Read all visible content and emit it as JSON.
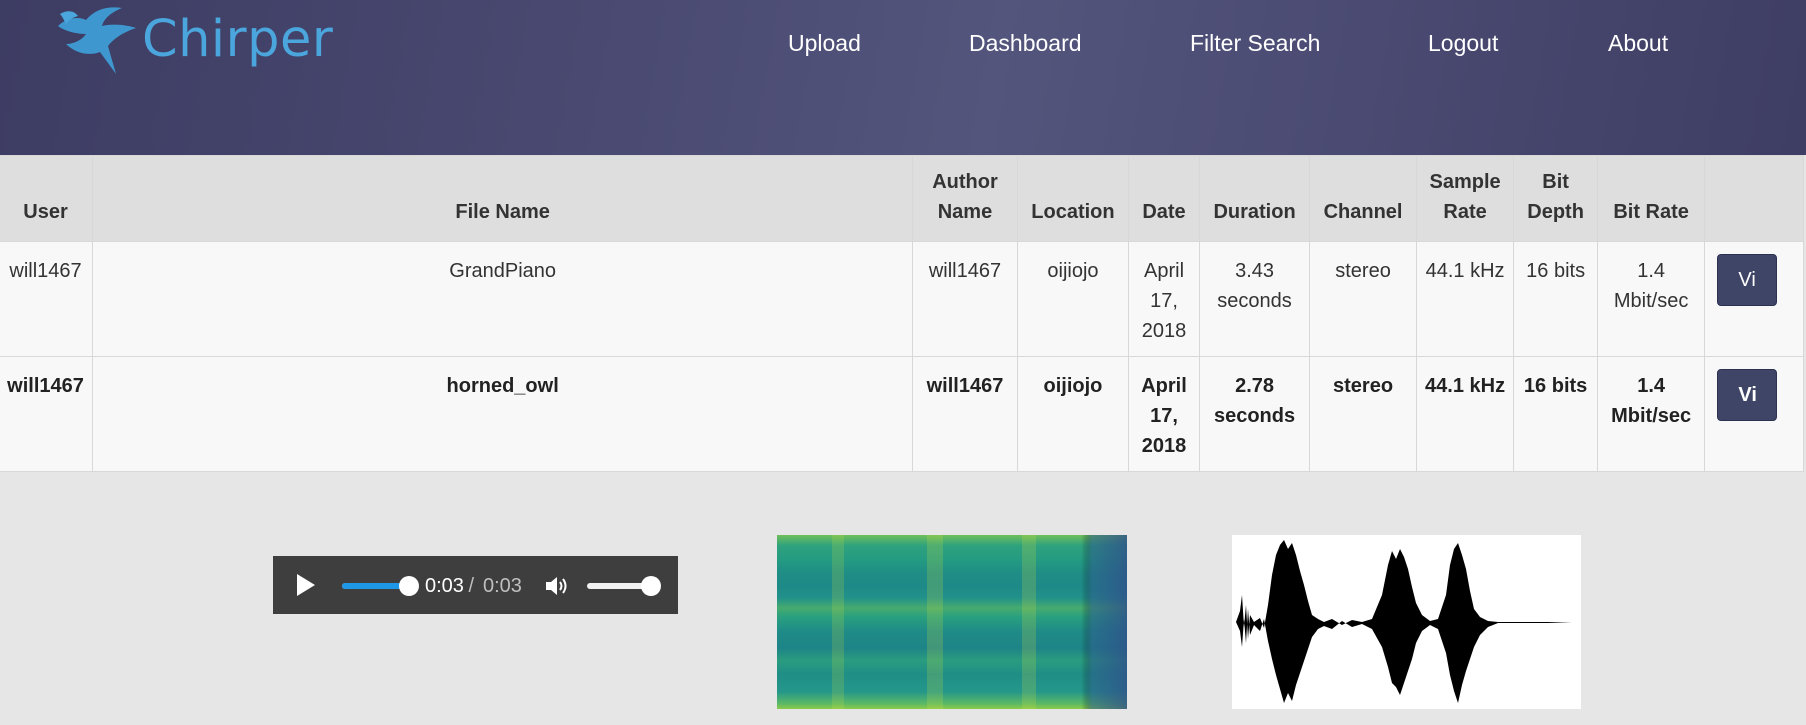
{
  "brand": {
    "name": "Chirper",
    "logo_color": "#4aa6dc"
  },
  "nav": {
    "items": [
      "Upload",
      "Dashboard",
      "Filter Search",
      "Logout",
      "About"
    ]
  },
  "table": {
    "headers": [
      "User",
      "File Name",
      "Author Name",
      "Location",
      "Date",
      "Duration",
      "Channel",
      "Sample Rate",
      "Bit Depth",
      "Bit Rate",
      ""
    ],
    "rows": [
      {
        "user": "will1467",
        "file_name": "GrandPiano",
        "author": "will1467",
        "location": "oijiojo",
        "date": "April 17, 2018",
        "duration": "3.43 seconds",
        "channel": "stereo",
        "sample_rate": "44.1 kHz",
        "bit_depth": "16 bits",
        "bit_rate": "1.4 Mbit/sec",
        "action": "Vi",
        "selected": false
      },
      {
        "user": "will1467",
        "file_name": "horned_owl",
        "author": "will1467",
        "location": "oijiojo",
        "date": "April 17, 2018",
        "duration": "2.78 seconds",
        "channel": "stereo",
        "sample_rate": "44.1 kHz",
        "bit_depth": "16 bits",
        "bit_rate": "1.4 Mbit/sec",
        "action": "Vi",
        "selected": true
      }
    ]
  },
  "player": {
    "current_time": "0:03",
    "separator": " / ",
    "duration": "0:03",
    "progress": 1.0,
    "volume": 1.0,
    "play_icon": "play-icon",
    "volume_icon": "volume-icon",
    "accent": "#1e98e6"
  }
}
